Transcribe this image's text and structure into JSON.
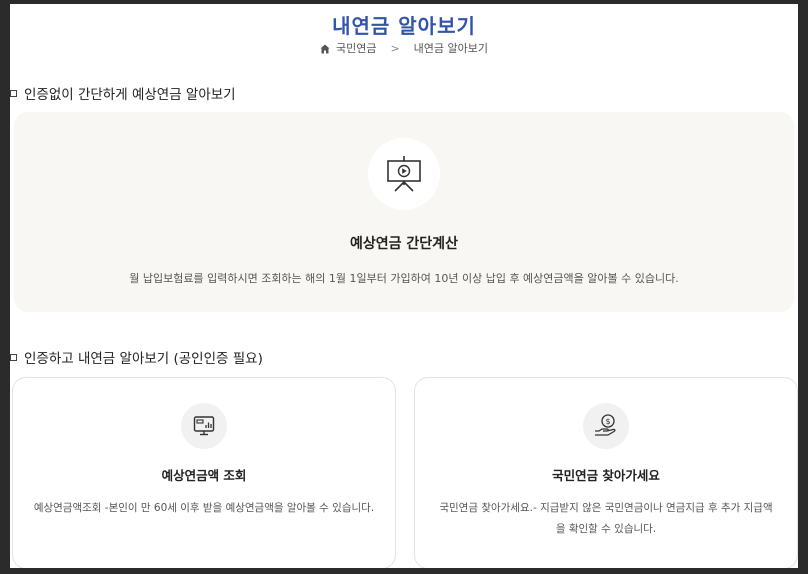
{
  "header": {
    "title": "내연금 알아보기",
    "breadcrumb": {
      "home_label": "국민연금",
      "separator": ">",
      "current": "내연금 알아보기"
    }
  },
  "section1": {
    "title": "인증없이 간단하게 예상연금 알아보기",
    "calc": {
      "icon": "presentation-play-icon",
      "title": "예상연금 간단계산",
      "desc": "월 납입보험료를 입력하시면 조회하는 해의 1월 1일부터 가입하여 10년 이상 납입 후 예상연금액을 알아볼 수 있습니다."
    }
  },
  "section2": {
    "title": "인증하고 내연금 알아보기 (공인인증 필요)",
    "cards": [
      {
        "icon": "monitor-chart-icon",
        "title": "예상연금액 조회",
        "desc": "예상연금액조회 -본인이 만 60세 이후 받을 예상연금액을 알아볼 수 있습니다."
      },
      {
        "icon": "hand-coin-icon",
        "title": "국민연금 찾아가세요",
        "desc": "국민연금 찾아가세요.- 지급받지 않은 국민연금이나 연금지급 후 추가 지급액을 확인할 수 있습니다."
      }
    ]
  },
  "colors": {
    "title_blue": "#3355a8",
    "calc_bg": "#f8f7f4"
  }
}
